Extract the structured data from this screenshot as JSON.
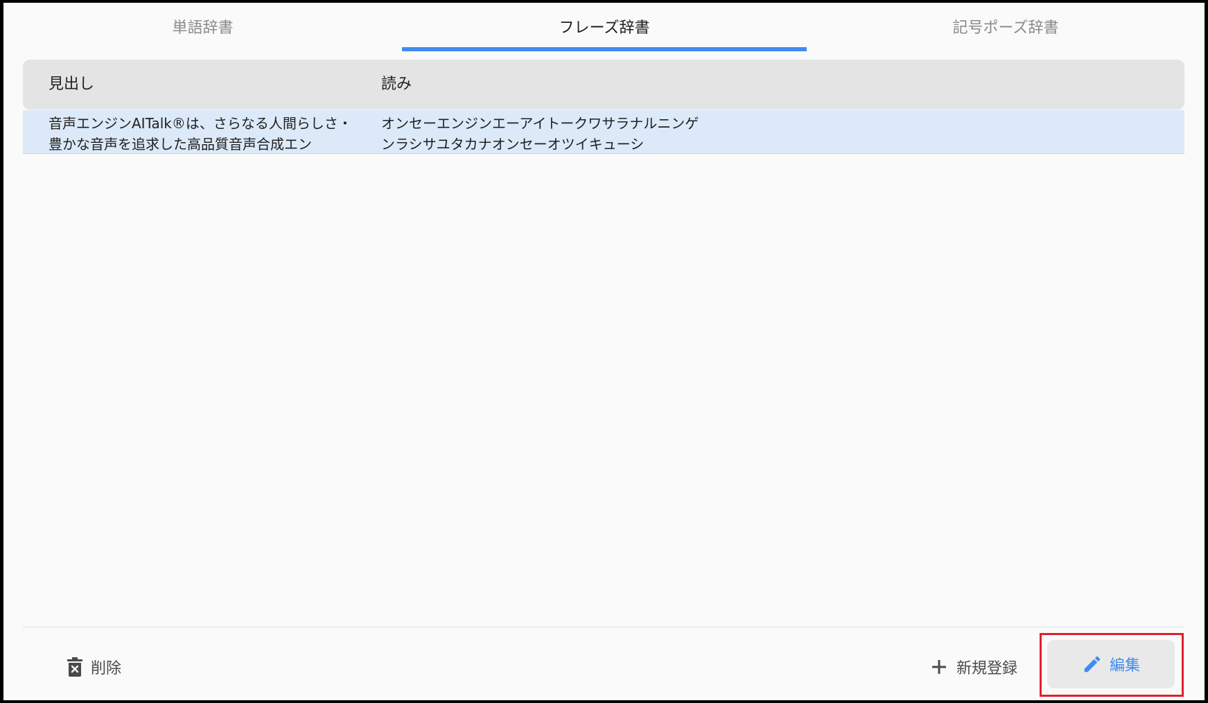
{
  "tabs": [
    {
      "label": "単語辞書",
      "active": false
    },
    {
      "label": "フレーズ辞書",
      "active": true
    },
    {
      "label": "記号ポーズ辞書",
      "active": false
    }
  ],
  "table": {
    "columns": [
      "見出し",
      "読み"
    ],
    "rows": [
      {
        "heading": "音声エンジンAITalk®は、さらなる人間らしさ・豊かな音声を追求した高品質音声合成エン",
        "reading": "オンセーエンジンエーアイトークワサラナルニンゲンラシサユタカナオンセーオツイキューシ"
      }
    ]
  },
  "footer": {
    "delete_label": "削除",
    "new_label": "新規登録",
    "edit_label": "編集"
  },
  "icons": {
    "delete": "trash-icon",
    "new": "plus-icon",
    "edit": "pencil-icon"
  },
  "colors": {
    "accent": "#3f8cf0",
    "selected_row": "#dce9f8",
    "header_bg": "#e4e4e4",
    "highlight": "#e0202a"
  }
}
